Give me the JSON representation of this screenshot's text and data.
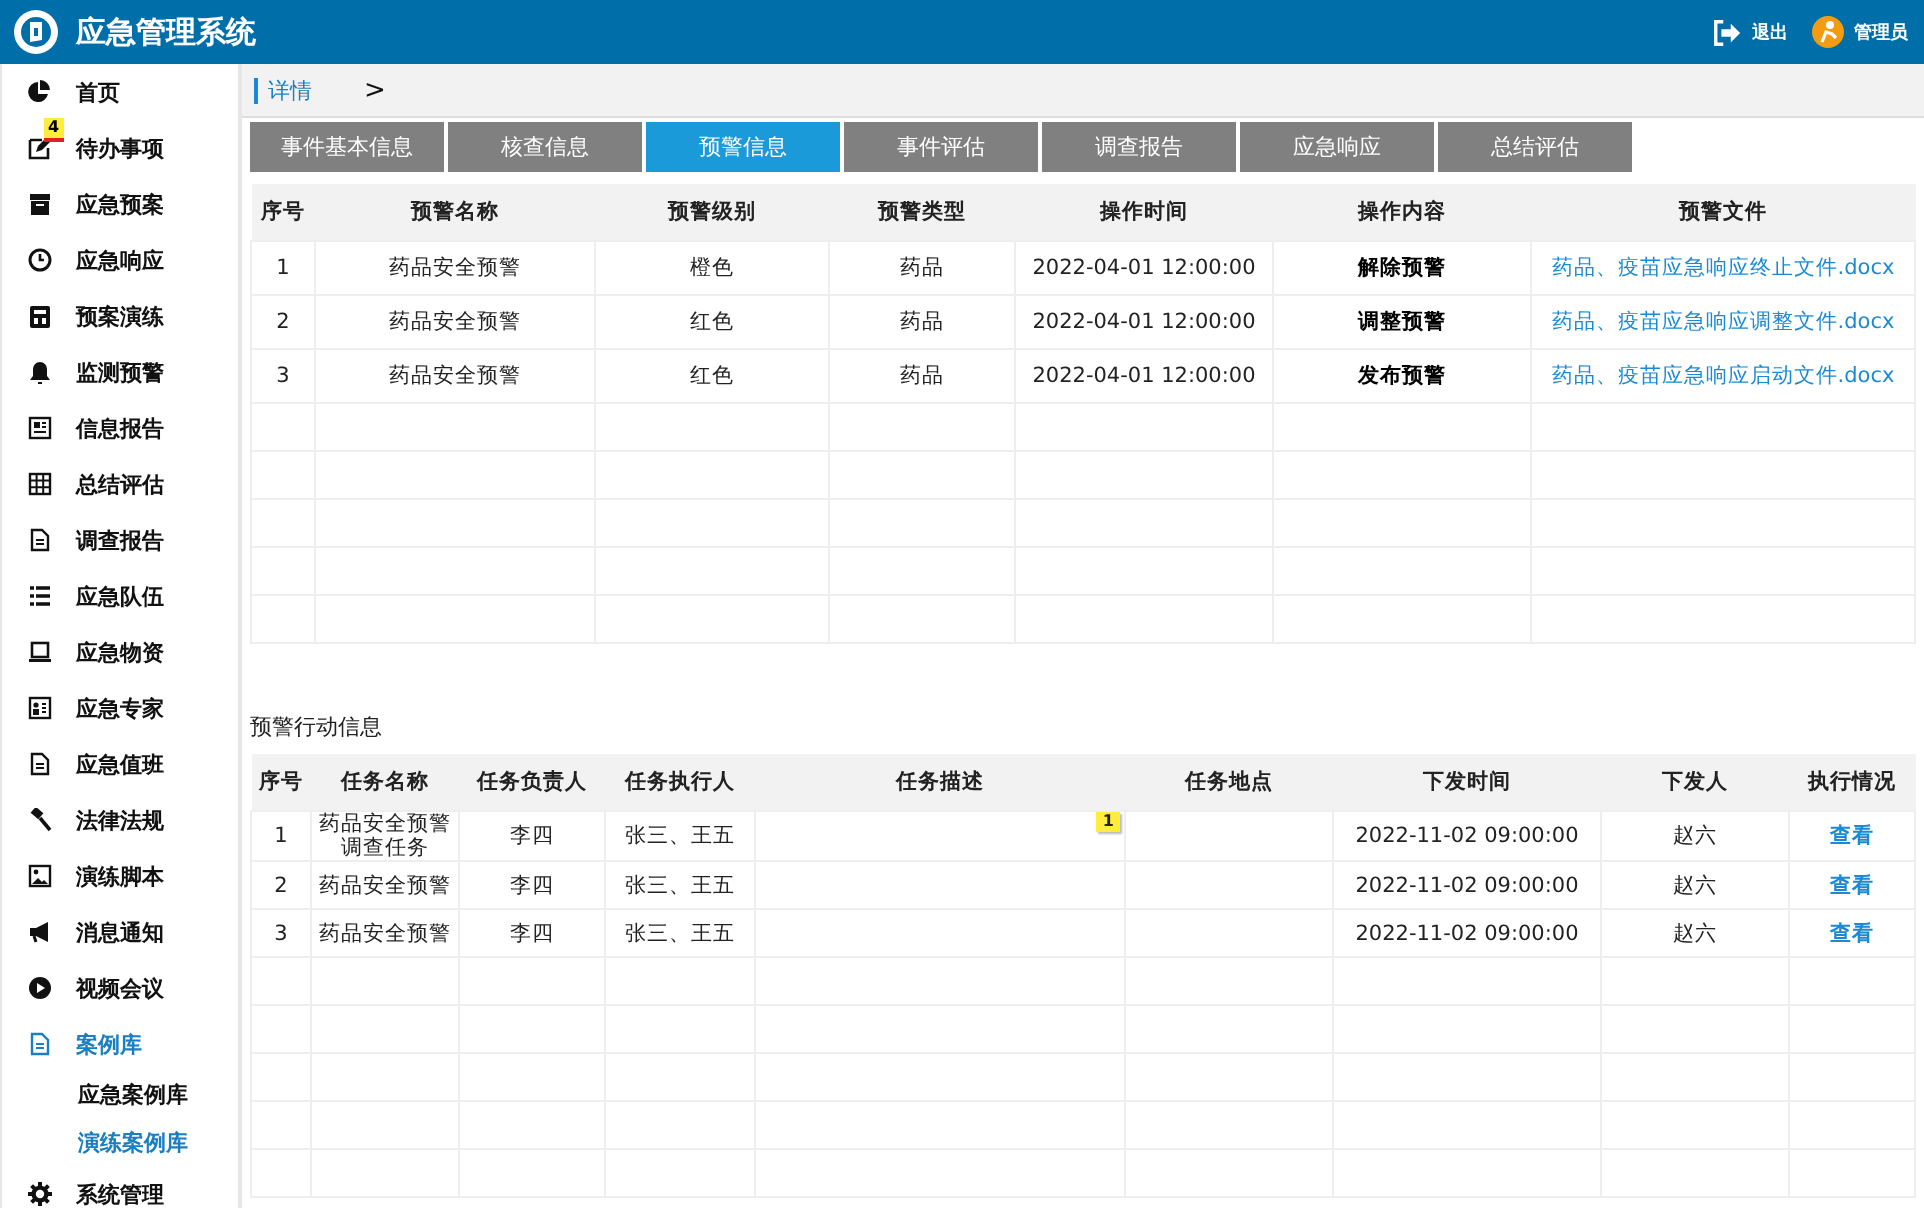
{
  "header": {
    "title": "应急管理系统",
    "actions": [
      {
        "kind": "logout",
        "label": "退出"
      },
      {
        "kind": "user",
        "label": "管理员"
      }
    ]
  },
  "sidebar": {
    "items": [
      {
        "label": "首页",
        "selected": false
      },
      {
        "label": "待办事项",
        "selected": false,
        "badge": "4"
      },
      {
        "label": "应急预案",
        "selected": false
      },
      {
        "label": "应急响应",
        "selected": false
      },
      {
        "label": "预案演练",
        "selected": false
      },
      {
        "label": "监测预警",
        "selected": false
      },
      {
        "label": "信息报告",
        "selected": false
      },
      {
        "label": "总结评估",
        "selected": false
      },
      {
        "label": "调查报告",
        "selected": false
      },
      {
        "label": "应急队伍",
        "selected": false
      },
      {
        "label": "应急物资",
        "selected": false
      },
      {
        "label": "应急专家",
        "selected": false
      },
      {
        "label": "应急值班",
        "selected": false
      },
      {
        "label": "法律法规",
        "selected": false
      },
      {
        "label": "演练脚本",
        "selected": false
      },
      {
        "label": "消息通知",
        "selected": false
      },
      {
        "label": "视频会议",
        "selected": false
      },
      {
        "label": "案例库",
        "selected": true,
        "children": [
          {
            "label": "应急案例库",
            "selected": false
          },
          {
            "label": "演练案例库",
            "selected": true
          }
        ]
      },
      {
        "label": "系统管理",
        "selected": false
      }
    ]
  },
  "breadcrumb": {
    "label": "详情",
    "separator": ">"
  },
  "tabs": [
    {
      "label": "事件基本信息",
      "selected": false
    },
    {
      "label": "核查信息",
      "selected": false
    },
    {
      "label": "预警信息",
      "selected": true
    },
    {
      "label": "事件评估",
      "selected": false
    },
    {
      "label": "调查报告",
      "selected": false
    },
    {
      "label": "应急响应",
      "selected": false
    },
    {
      "label": "总结评估",
      "selected": false
    }
  ],
  "warning_table": {
    "columns": [
      {
        "label": "序号",
        "kind": "text"
      },
      {
        "label": "预警名称",
        "kind": "text"
      },
      {
        "label": "预警级别",
        "kind": "text"
      },
      {
        "label": "预警类型",
        "kind": "text"
      },
      {
        "label": "操作时间",
        "kind": "text"
      },
      {
        "label": "操作内容",
        "kind": "strong"
      },
      {
        "label": "预警文件",
        "kind": "link"
      }
    ],
    "rows": [
      {
        "cells": [
          "1",
          "药品安全预警",
          "橙色",
          "药品",
          "2022-04-01 12:00:00",
          "解除预警",
          "药品、疫苗应急响应终止文件.docx"
        ]
      },
      {
        "cells": [
          "2",
          "药品安全预警",
          "红色",
          "药品",
          "2022-04-01 12:00:00",
          "调整预警",
          "药品、疫苗应急响应调整文件.docx"
        ]
      },
      {
        "cells": [
          "3",
          "药品安全预警",
          "红色",
          "药品",
          "2022-04-01 12:00:00",
          "发布预警",
          "药品、疫苗应急响应启动文件.docx"
        ]
      }
    ]
  },
  "action_section": {
    "title": "预警行动信息",
    "table": {
      "columns": [
        {
          "label": "序号",
          "kind": "text"
        },
        {
          "label": "任务名称",
          "kind": "text"
        },
        {
          "label": "任务负责人",
          "kind": "text"
        },
        {
          "label": "任务执行人",
          "kind": "text"
        },
        {
          "label": "任务描述",
          "kind": "text"
        },
        {
          "label": "任务地点",
          "kind": "text"
        },
        {
          "label": "下发时间",
          "kind": "text"
        },
        {
          "label": "下发人",
          "kind": "text"
        },
        {
          "label": "执行情况",
          "kind": "link"
        }
      ],
      "rows": [
        {
          "cells": [
            "1",
            "药品安全预警调查任务",
            "李四",
            "张三、王五",
            {
              "badge": "1"
            },
            null,
            "2022-11-02 09:00:00",
            "赵六",
            "查看"
          ]
        },
        {
          "cells": [
            "2",
            "药品安全预警",
            "李四",
            "张三、王五",
            null,
            null,
            "2022-11-02 09:00:00",
            "赵六",
            "查看"
          ]
        },
        {
          "cells": [
            "3",
            "药品安全预警",
            "李四",
            "张三、王五",
            null,
            null,
            "2022-11-02 09:00:00",
            "赵六",
            "查看"
          ]
        }
      ]
    }
  }
}
